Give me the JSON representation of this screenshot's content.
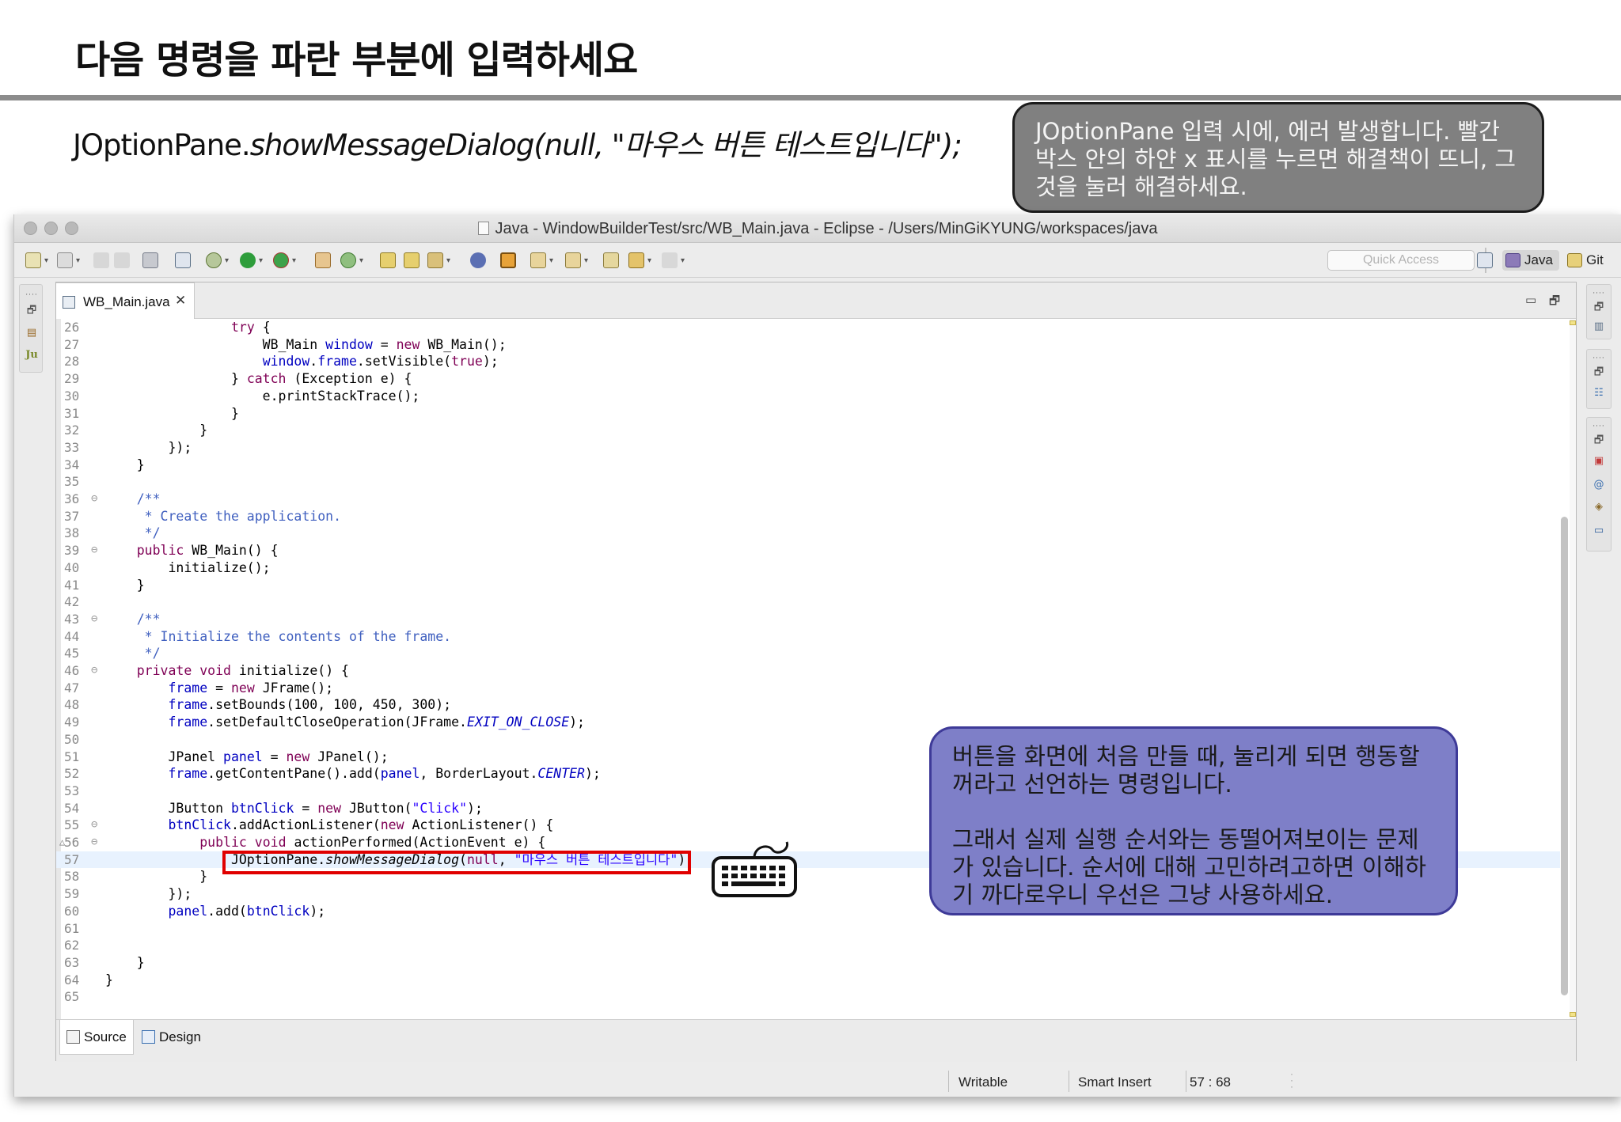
{
  "slide": {
    "title": "다음 명령을 파란 부분에 입력하세요",
    "command": {
      "prefix": "JOptionPane.",
      "method_call": "showMessageDialog(null,   \"마우스 버튼 테스트입니다\");"
    },
    "note_top": "JOptionPane 입력 시에, 에러 발생합니다.  빨간 박스 안의 하얀 x 표시를 누르면 해결책이 뜨니, 그것을 눌러 해결하세요.",
    "note_bottom": {
      "paragraph1": "버튼을 화면에 처음 만들 때, 눌리게 되면 행동할 꺼라고 선언하는 명령입니다.",
      "paragraph2": "그래서 실제 실행 순서와는 동떨어져보이는 문제가 있습니다. 순서에 대해 고민하려고하면 이해하기 까다로우니 우선은 그냥 사용하세요."
    }
  },
  "window": {
    "title": "Java - WindowBuilderTest/src/WB_Main.java - Eclipse - /Users/MinGiKYUNG/workspaces/java",
    "quick_access_placeholder": "Quick Access",
    "perspectives": [
      {
        "label": "Java",
        "active": true,
        "icon": "java-perspective-icon"
      },
      {
        "label": "Git",
        "active": false,
        "icon": "git-perspective-icon"
      }
    ],
    "editor_tab": {
      "label": "WB_Main.java",
      "close": "✕"
    },
    "bottom_tabs": [
      {
        "label": "Source",
        "active": true
      },
      {
        "label": "Design",
        "active": false
      }
    ],
    "status": {
      "writable": "Writable",
      "insert_mode": "Smart Insert",
      "cursor": "57 : 68"
    }
  },
  "code": {
    "current_line": 57,
    "lines": [
      {
        "n": "26",
        "code": "                try {"
      },
      {
        "n": "27",
        "code": "                    WB_Main window = new WB_Main();"
      },
      {
        "n": "28",
        "code": "                    window.frame.setVisible(true);"
      },
      {
        "n": "29",
        "code": "                } catch (Exception e) {"
      },
      {
        "n": "30",
        "code": "                    e.printStackTrace();"
      },
      {
        "n": "31",
        "code": "                }"
      },
      {
        "n": "32",
        "code": "            }"
      },
      {
        "n": "33",
        "code": "        });"
      },
      {
        "n": "34",
        "code": "    }"
      },
      {
        "n": "35",
        "code": ""
      },
      {
        "n": "36",
        "fold": true,
        "code": "    /**"
      },
      {
        "n": "37",
        "code": "     * Create the application."
      },
      {
        "n": "38",
        "code": "     */"
      },
      {
        "n": "39",
        "fold": true,
        "code": "    public WB_Main() {"
      },
      {
        "n": "40",
        "code": "        initialize();"
      },
      {
        "n": "41",
        "code": "    }"
      },
      {
        "n": "42",
        "code": ""
      },
      {
        "n": "43",
        "fold": true,
        "code": "    /**"
      },
      {
        "n": "44",
        "code": "     * Initialize the contents of the frame."
      },
      {
        "n": "45",
        "code": "     */"
      },
      {
        "n": "46",
        "fold": true,
        "code": "    private void initialize() {"
      },
      {
        "n": "47",
        "code": "        frame = new JFrame();"
      },
      {
        "n": "48",
        "code": "        frame.setBounds(100, 100, 450, 300);"
      },
      {
        "n": "49",
        "code": "        frame.setDefaultCloseOperation(JFrame.EXIT_ON_CLOSE);"
      },
      {
        "n": "50",
        "code": ""
      },
      {
        "n": "51",
        "code": "        JPanel panel = new JPanel();"
      },
      {
        "n": "52",
        "code": "        frame.getContentPane().add(panel, BorderLayout.CENTER);"
      },
      {
        "n": "53",
        "code": ""
      },
      {
        "n": "54",
        "code": "        JButton btnClick = new JButton(\"Click\");"
      },
      {
        "n": "55",
        "fold": true,
        "code": "        btnClick.addActionListener(new ActionListener() {"
      },
      {
        "n": "56",
        "fold": true,
        "warn": true,
        "code": "            public void actionPerformed(ActionEvent e) {"
      },
      {
        "n": "57",
        "code": "                JOptionPane.showMessageDialog(null, \"마우스 버튼 테스트입니다\")"
      },
      {
        "n": "58",
        "code": "            }"
      },
      {
        "n": "59",
        "code": "        });"
      },
      {
        "n": "60",
        "code": "        panel.add(btnClick);"
      },
      {
        "n": "61",
        "code": ""
      },
      {
        "n": "62",
        "code": ""
      },
      {
        "n": "63",
        "code": "    }"
      },
      {
        "n": "64",
        "code": "}"
      },
      {
        "n": "65",
        "code": ""
      }
    ]
  },
  "colors": {
    "keyword": "#7f0055",
    "field": "#0000c0",
    "string": "#2a00ff",
    "comment": "#3f5fbf",
    "highlight_box": "#e00000",
    "note_bottom_bg": "#7e7fc8",
    "note_top_bg": "#808080"
  },
  "icons": {
    "keyboard": "keyboard-icon",
    "close_tab": "close-icon"
  }
}
